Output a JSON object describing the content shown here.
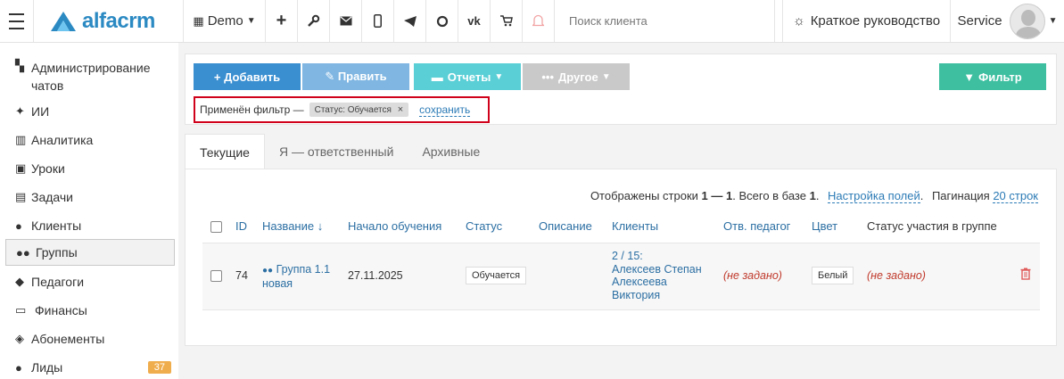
{
  "header": {
    "logo_text": "alfacrm",
    "branch": "Demo",
    "search_placeholder": "Поиск клиента",
    "guide_label": "Краткое руководство",
    "user_name": "Service",
    "brand_color": "#2c8ac3"
  },
  "sidebar": {
    "items": [
      {
        "label": "Администрирование чатов",
        "icon": "chat-icon"
      },
      {
        "label": "ИИ",
        "icon": "sparkle-icon"
      },
      {
        "label": "Аналитика",
        "icon": "map-icon"
      },
      {
        "label": "Уроки",
        "icon": "calendar-icon"
      },
      {
        "label": "Задачи",
        "icon": "clipboard-icon"
      },
      {
        "label": "Клиенты",
        "icon": "user-icon"
      },
      {
        "label": "Группы",
        "icon": "users-icon"
      },
      {
        "label": "Педагоги",
        "icon": "graduation-cap-icon"
      },
      {
        "label": "Финансы",
        "icon": "money-icon"
      },
      {
        "label": "Абонементы",
        "icon": "tag-icon"
      },
      {
        "label": "Лиды",
        "icon": "user-plus-icon",
        "badge": "37"
      }
    ]
  },
  "toolbar": {
    "add_label": "+ Добавить",
    "edit_label": "✎ Править",
    "reports_label": "Отчеты",
    "other_label": "Другое",
    "filter_label": "Фильтр"
  },
  "filter": {
    "applied_label": "Применён фильтр —",
    "chip_label": "Статус: Обучается",
    "chip_close": "×",
    "save_label": "сохранить"
  },
  "tabs": [
    {
      "label": "Текущие",
      "active": true
    },
    {
      "label": "Я — ответственный",
      "active": false
    },
    {
      "label": "Архивные",
      "active": false
    }
  ],
  "info": {
    "shown_prefix": "Отображены строки",
    "shown_range": "1 — 1",
    "total_prefix": ". Всего в базе",
    "total": "1",
    "fields_link": "Настройка полей",
    "pagination_label": "Пагинация",
    "pagination_value": "20 строк"
  },
  "table": {
    "headers": [
      "ID",
      "Название ↓",
      "Начало обучения",
      "Статус",
      "Описание",
      "Клиенты",
      "Отв. педагог",
      "Цвет",
      "Статус участия в группе"
    ],
    "rows": [
      {
        "id": "74",
        "name_line1": "Группа 1.1",
        "name_line2": "новая",
        "start": "27.11.2025",
        "status": "Обучается",
        "description": "",
        "clients_count": "2 / 15:",
        "client1": "Алексеев Степан",
        "client2": "Алексеева",
        "client3": "Виктория",
        "teacher": "(не задано)",
        "color": "Белый",
        "participation": "(не задано)"
      }
    ]
  }
}
